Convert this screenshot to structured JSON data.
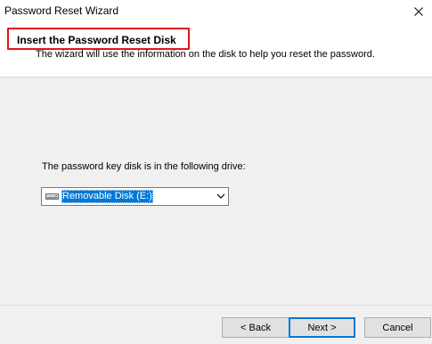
{
  "window": {
    "title": "Password Reset Wizard"
  },
  "header": {
    "title": "Insert the Password Reset Disk",
    "subtitle": "The wizard will use the information on the disk to help you reset the password."
  },
  "content": {
    "drive_label": "The password key disk is in the following drive:",
    "drive_select": {
      "selected": "Removable Disk (E:)"
    }
  },
  "buttons": {
    "back": "< Back",
    "next": "Next >",
    "cancel": "Cancel"
  },
  "icons": {
    "close": "close-icon",
    "drive": "removable-disk-icon",
    "dropdown": "chevron-down-icon"
  },
  "colors": {
    "highlight_border": "#e2131b",
    "selection": "#0078d7",
    "default_button_border": "#0078d7"
  }
}
